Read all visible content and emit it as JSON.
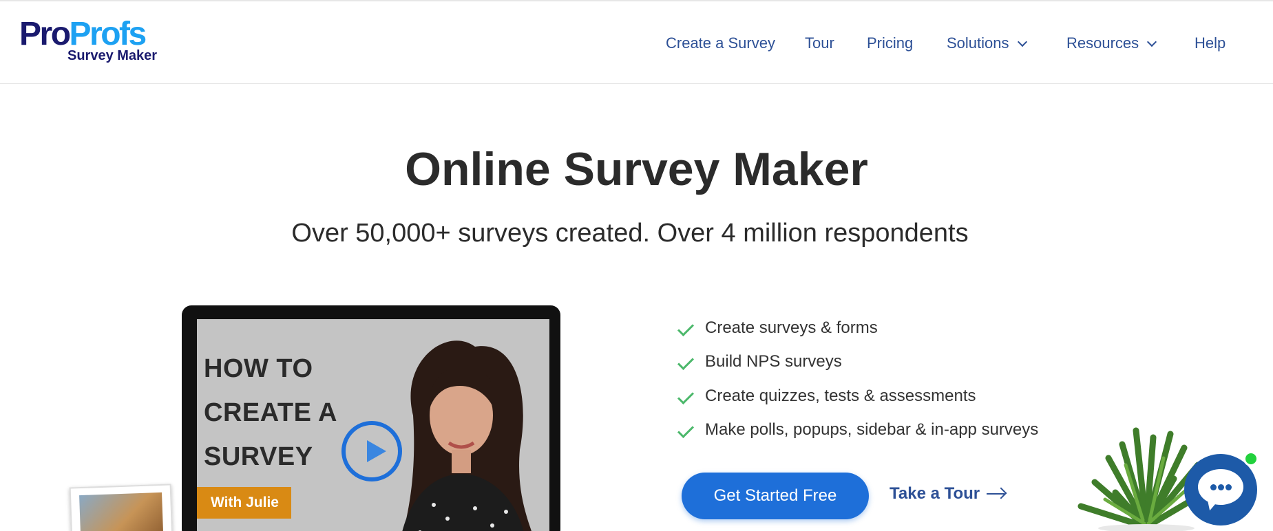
{
  "logo": {
    "brand_part1": "Pro",
    "brand_part2": "Profs",
    "product": "Survey Maker"
  },
  "nav": {
    "items": [
      {
        "label": "Create a Survey",
        "has_dropdown": false
      },
      {
        "label": "Tour",
        "has_dropdown": false
      },
      {
        "label": "Pricing",
        "has_dropdown": false
      },
      {
        "label": "Solutions",
        "has_dropdown": true
      },
      {
        "label": "Resources",
        "has_dropdown": true
      },
      {
        "label": "Help",
        "has_dropdown": false
      }
    ]
  },
  "hero": {
    "title": "Online Survey Maker",
    "subtitle": "Over 50,000+ surveys created. Over 4 million respondents"
  },
  "video": {
    "lines": [
      "HOW TO",
      "CREATE A",
      "SURVEY"
    ],
    "badge": "With Julie"
  },
  "features": [
    "Create surveys & forms",
    "Build NPS surveys",
    "Create quizzes, tests & assessments",
    "Make polls, popups, sidebar & in-app surveys"
  ],
  "cta": {
    "primary_label": "Get Started Free",
    "secondary_label": "Take a Tour"
  },
  "colors": {
    "brand_dark": "#1a1a6e",
    "brand_light": "#1da1f2",
    "nav_text": "#2d5096",
    "cta_bg": "#1e6fd9",
    "check_green": "#4cb86b",
    "badge_orange": "#d98a14",
    "chat_bg": "#1d5aa8",
    "online_green": "#22d13d"
  },
  "icons": {
    "check": "check-icon",
    "chevron": "chevron-down-icon",
    "play": "play-icon",
    "arrow": "arrow-right-icon",
    "chat": "chat-icon"
  }
}
